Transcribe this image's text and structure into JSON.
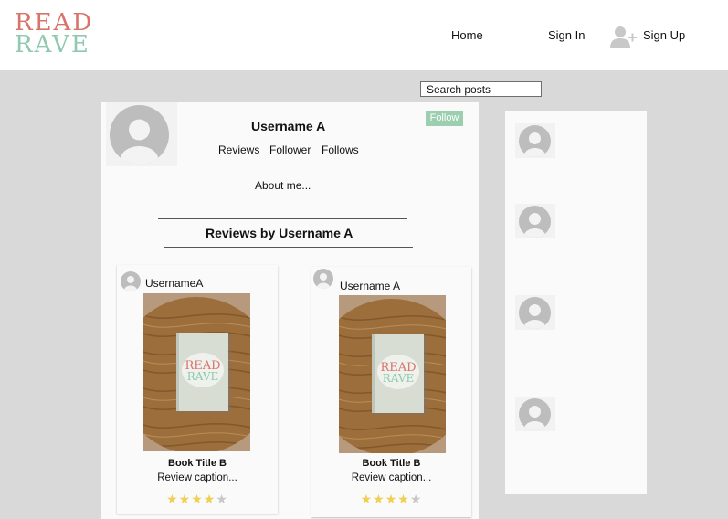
{
  "logo": {
    "line1": "READ",
    "line2": "RAVE"
  },
  "nav": {
    "home": "Home",
    "sign_in": "Sign In",
    "sign_up": "Sign Up",
    "sign_up_icon": "add-user-icon"
  },
  "search": {
    "value": "Search posts"
  },
  "profile": {
    "avatar_icon": "user-avatar-icon",
    "username": "Username A",
    "follow_label": "Follow",
    "stats": {
      "reviews": "Reviews",
      "follower": "Follower",
      "follows": "Follows"
    },
    "about": "About me...",
    "reviews_heading": "Reviews by Username A"
  },
  "reviews": [
    {
      "username": "UsernameA",
      "cover_text": {
        "line1": "READ",
        "line2": "RAVE"
      },
      "book_title": "Book Title B",
      "caption": "Review caption...",
      "rating": 4,
      "max_rating": 5
    },
    {
      "username": "Username A",
      "cover_text": {
        "line1": "READ",
        "line2": "RAVE"
      },
      "book_title": "Book Title B",
      "caption": "Review caption...",
      "rating": 4,
      "max_rating": 5
    }
  ],
  "sidebar": {
    "avatar_count": 4,
    "avatar_icon": "user-avatar-icon"
  },
  "colors": {
    "logo_red": "#d9736a",
    "logo_teal": "#8fc9b0",
    "follow_green": "#9ccfaf",
    "star_gold": "#f0cf53",
    "page_bg": "#d9d9d9"
  }
}
